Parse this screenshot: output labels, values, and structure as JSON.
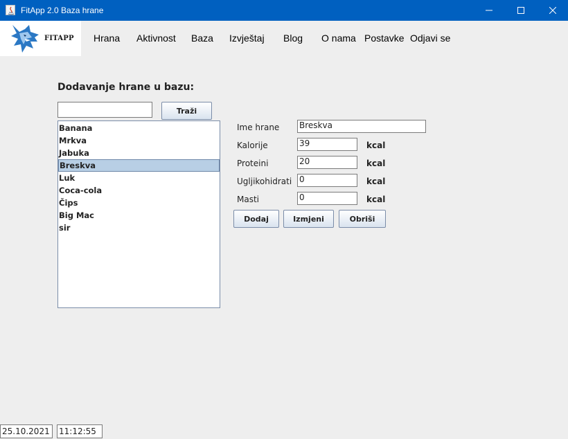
{
  "window": {
    "title": "FitApp 2.0 Baza hrane"
  },
  "logo": {
    "text": "FITAPP"
  },
  "menu": {
    "items": [
      "Hrana",
      "Aktivnost",
      "Baza",
      "Izvještaj",
      "Blog",
      "O nama",
      "Postavke",
      "Odjavi se"
    ]
  },
  "section": {
    "title": "Dodavanje hrane u bazu:"
  },
  "search": {
    "value": "",
    "button_label": "Traži"
  },
  "food_list": {
    "items": [
      "Banana",
      "Mrkva",
      "Jabuka",
      "Breskva",
      "Luk",
      "Coca-cola",
      "Čips",
      "Big Mac",
      "sir"
    ],
    "selected": "Breskva"
  },
  "form": {
    "name_label": "Ime hrane",
    "name_value": "Breskva",
    "calories_label": "Kalorije",
    "calories_value": "39",
    "proteins_label": "Proteini",
    "proteins_value": "20",
    "carbs_label": "Ugljikohidrati",
    "carbs_value": "0",
    "fats_label": "Masti",
    "fats_value": "0",
    "unit": "kcal"
  },
  "actions": {
    "add_label": "Dodaj",
    "edit_label": "Izmjeni",
    "delete_label": "Obriši"
  },
  "status": {
    "date": "25.10.2021",
    "time": "11:12:55"
  },
  "colors": {
    "titlebar": "#0060c0",
    "selection": "#b8cfe5",
    "background": "#eeeeee"
  }
}
